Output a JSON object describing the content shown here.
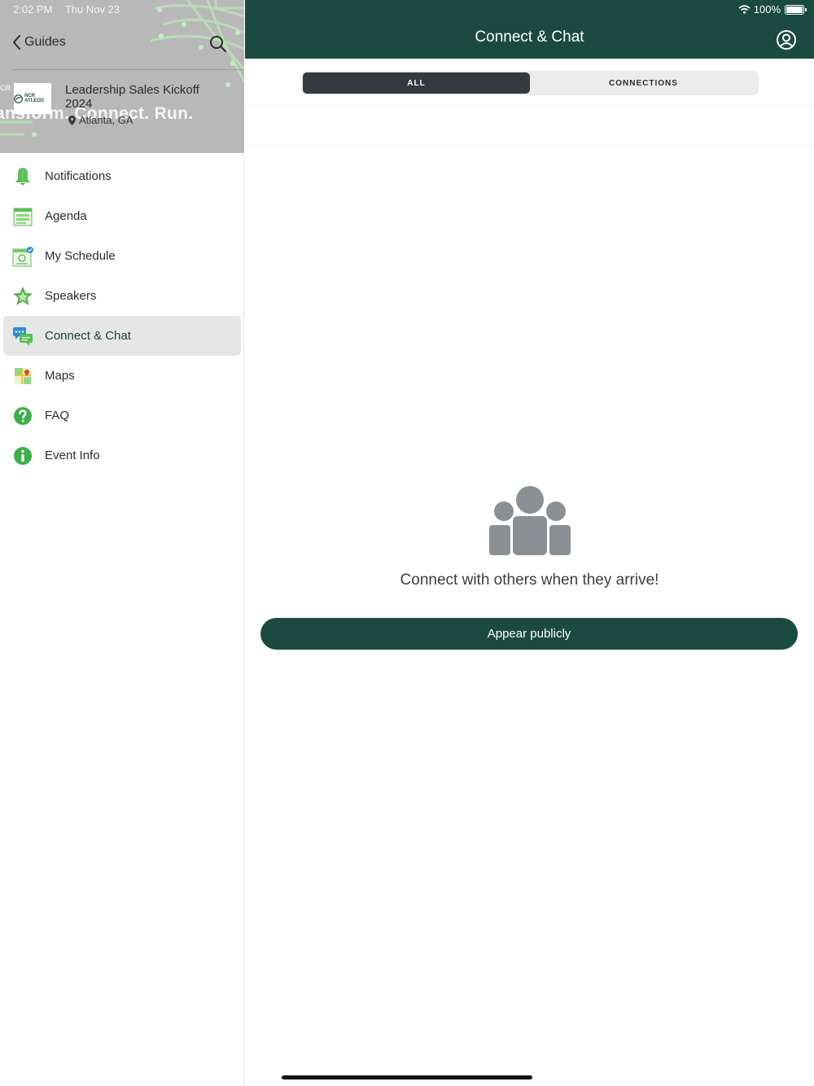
{
  "status_bar": {
    "time": "2:02 PM",
    "date": "Thu Nov 23",
    "battery": "100%"
  },
  "sidebar": {
    "back_label": "Guides",
    "banner_slogan": "ansform. Connect. Run.",
    "banner_brand": "CR",
    "event": {
      "logo_text": "NCR ATLEOS",
      "title": "Leadership Sales Kickoff 2024",
      "location": "Atlanta, GA"
    },
    "items": [
      {
        "label": "Notifications",
        "icon": "bell-icon"
      },
      {
        "label": "Agenda",
        "icon": "agenda-icon"
      },
      {
        "label": "My Schedule",
        "icon": "schedule-icon"
      },
      {
        "label": "Speakers",
        "icon": "star-icon"
      },
      {
        "label": "Connect & Chat",
        "icon": "chat-icon",
        "active": true
      },
      {
        "label": "Maps",
        "icon": "map-icon"
      },
      {
        "label": "FAQ",
        "icon": "question-icon"
      },
      {
        "label": "Event Info",
        "icon": "info-icon"
      }
    ]
  },
  "main": {
    "title": "Connect & Chat",
    "tabs": [
      {
        "label": "ALL",
        "active": true
      },
      {
        "label": "CONNECTIONS",
        "active": false
      }
    ],
    "empty_message": "Connect with others when they arrive!",
    "action_label": "Appear publicly"
  },
  "colors": {
    "brand_dark": "#1b4b40",
    "icon_green": "#3fae49",
    "segment_active": "#343a40"
  }
}
